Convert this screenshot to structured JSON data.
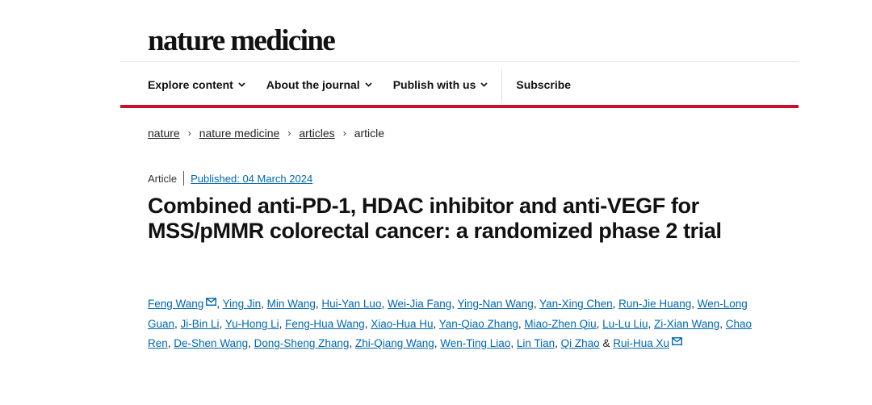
{
  "journal": {
    "logo_text": "nature medicine"
  },
  "nav": {
    "items": [
      {
        "label": "Explore content",
        "dropdown": true
      },
      {
        "label": "About the journal",
        "dropdown": true
      },
      {
        "label": "Publish with us",
        "dropdown": true
      },
      {
        "label": "Subscribe",
        "dropdown": false
      }
    ]
  },
  "breadcrumb": {
    "items": [
      "nature",
      "nature medicine",
      "articles",
      "article"
    ],
    "separator": "›"
  },
  "article": {
    "type": "Article",
    "published": "Published: 04 March 2024",
    "title": "Combined anti-PD-1, HDAC inhibitor and anti-VEGF for MSS/pMMR colorectal cancer: a randomized phase 2 trial",
    "authors": [
      "Feng Wang",
      "Ying Jin",
      "Min Wang",
      "Hui-Yan Luo",
      "Wei-Jia Fang",
      "Ying-Nan Wang",
      "Yan-Xing Chen",
      "Run-Jie Huang",
      "Wen-Long Guan",
      "Ji-Bin Li",
      "Yu-Hong Li",
      "Feng-Hua Wang",
      "Xiao-Hua Hu",
      "Yan-Qiao Zhang",
      "Miao-Zhen Qiu",
      "Lu-Lu Liu",
      "Zi-Xian Wang",
      "Chao Ren",
      "De-Shen Wang",
      "Dong-Sheng Zhang",
      "Zhi-Qiang Wang",
      "Wen-Ting Liao",
      "Lin Tian",
      "Qi Zhao",
      "Rui-Hua Xu"
    ],
    "corresponding_icon": "mail-icon",
    "and_word": "&"
  },
  "colors": {
    "accent_red": "#cc0d2c",
    "link_blue": "#0067b0"
  }
}
